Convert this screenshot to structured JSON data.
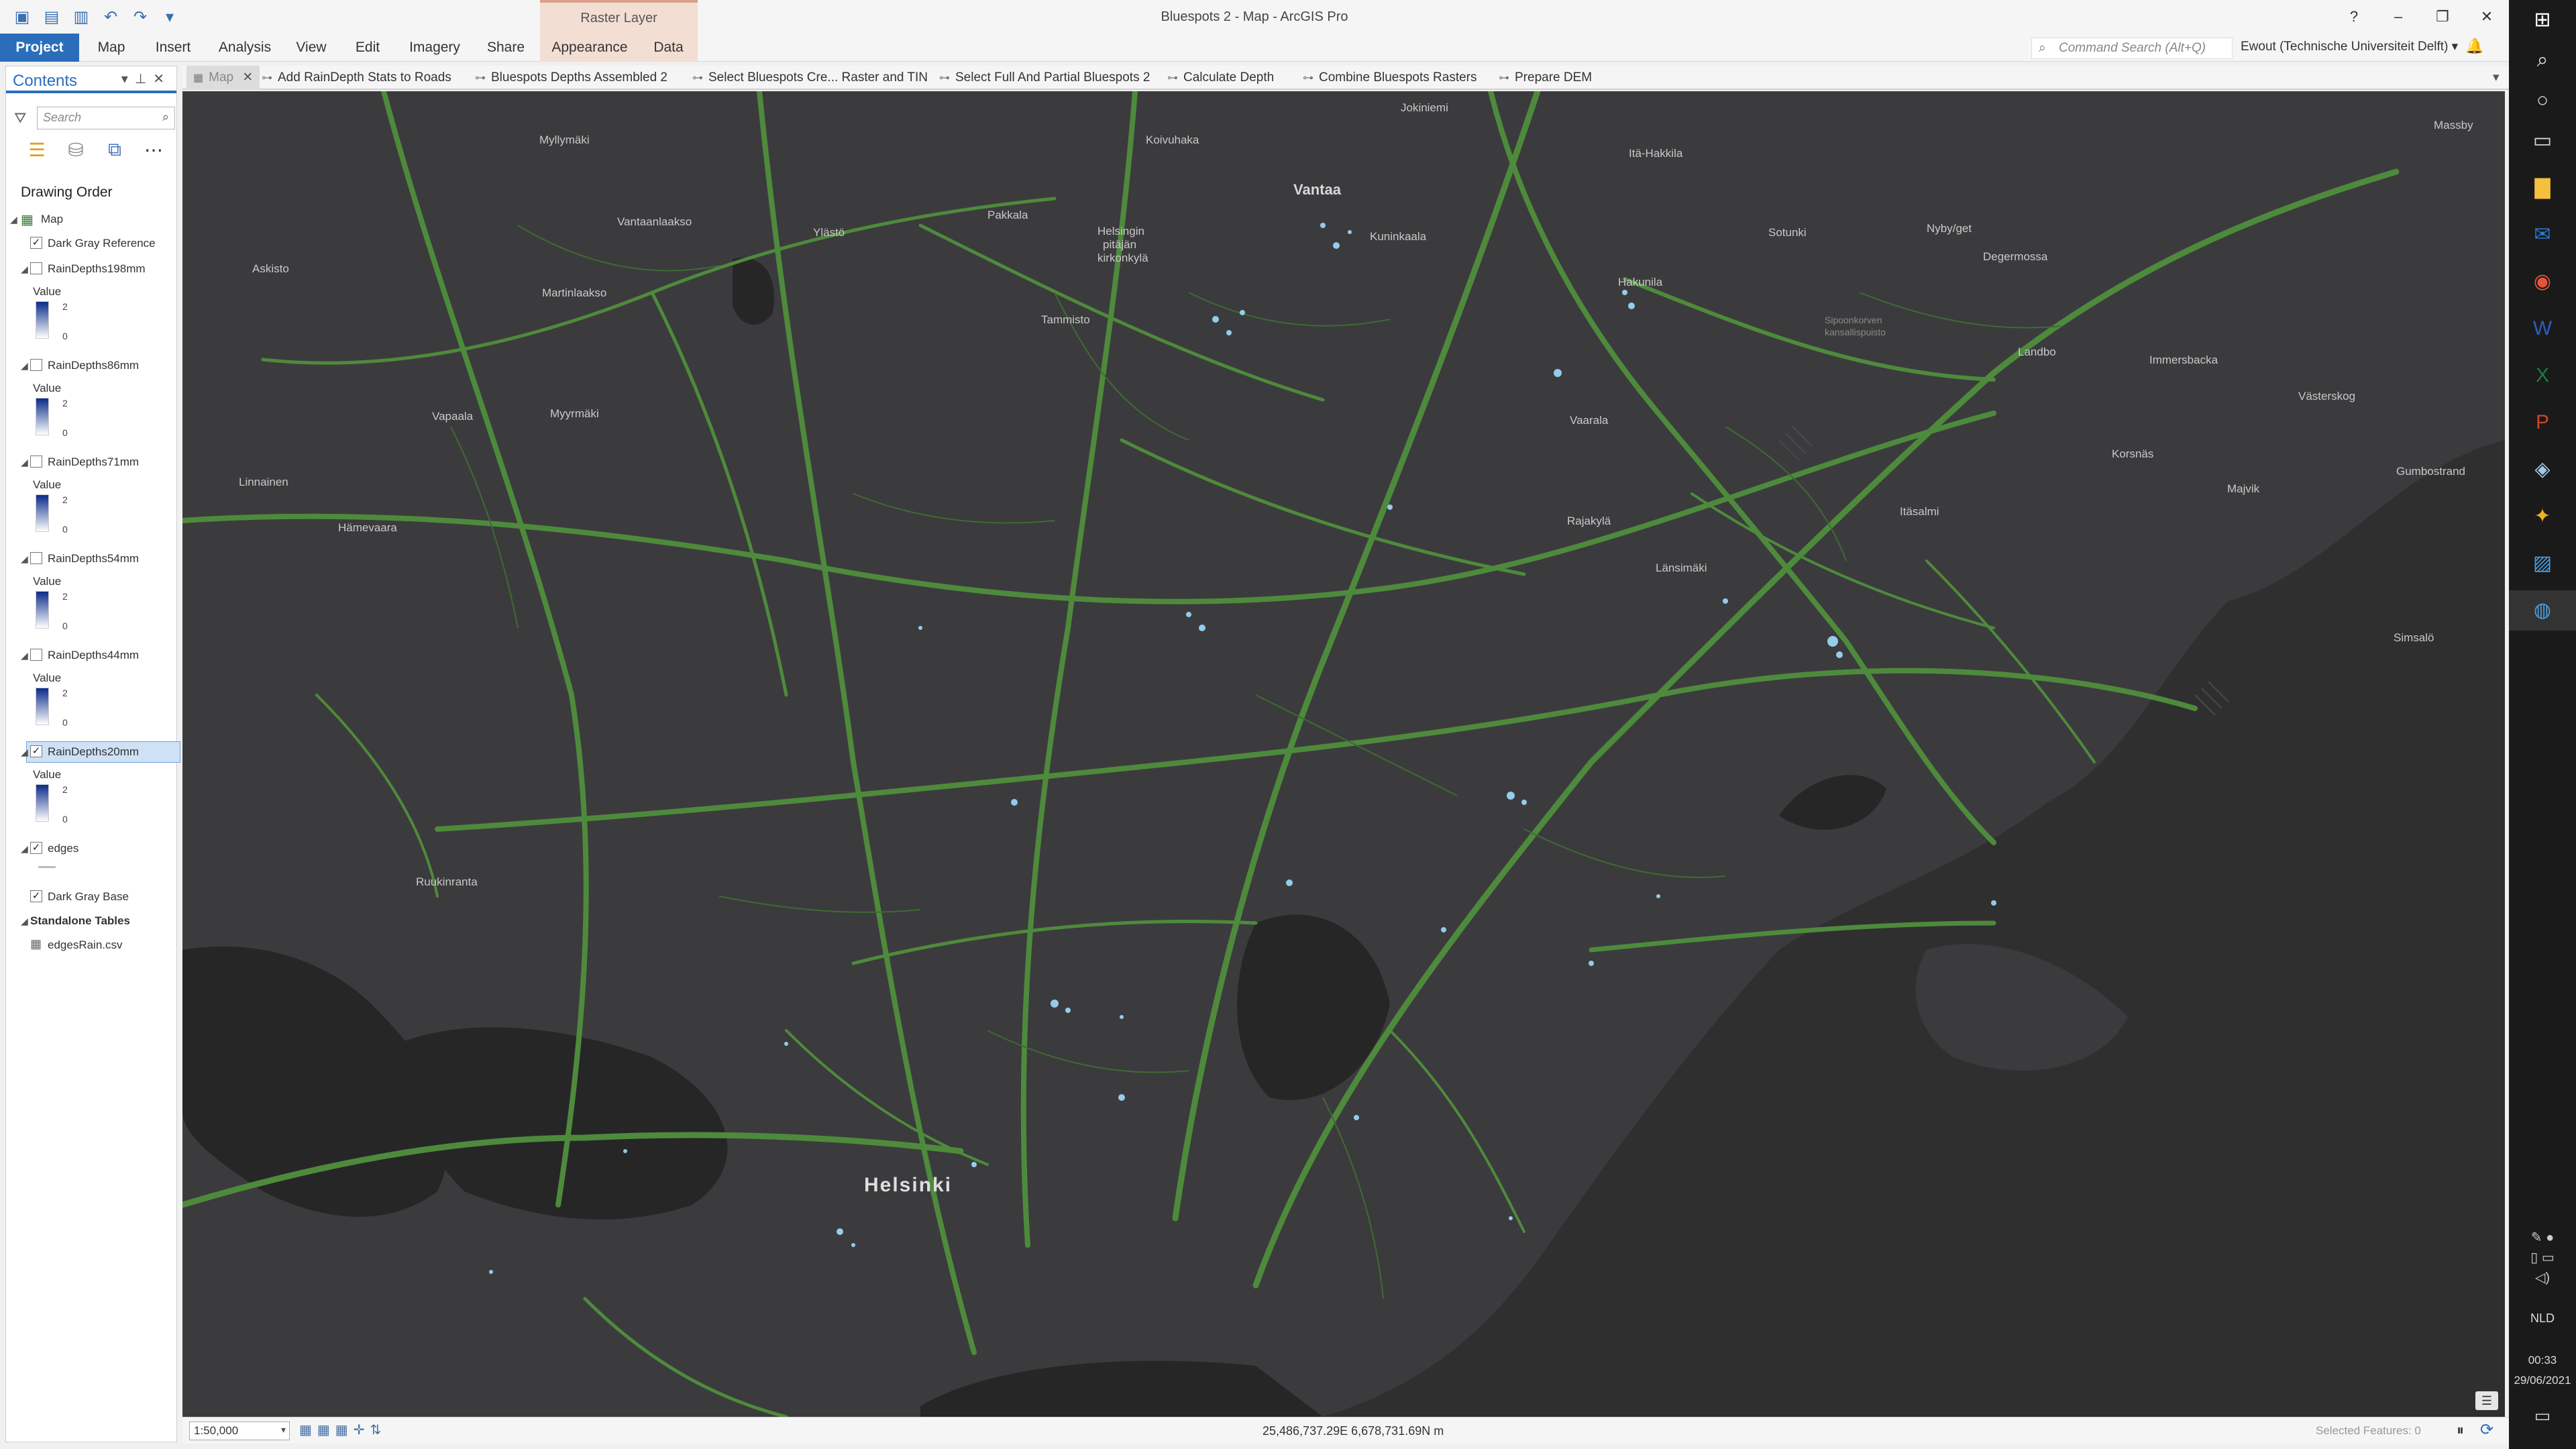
{
  "window": {
    "title": "Bluespots 2 - Map - ArcGIS Pro",
    "context_tab_header": "Raster Layer",
    "controls": [
      "?",
      "–",
      "❐",
      "✕"
    ]
  },
  "quick_access": [
    "new-project-icon",
    "open-project-icon",
    "save-project-icon",
    "undo-icon",
    "redo-icon",
    "customize-icon"
  ],
  "ribbon": {
    "tabs": [
      "Project",
      "Map",
      "Insert",
      "Analysis",
      "View",
      "Edit",
      "Imagery",
      "Share",
      "Appearance",
      "Data"
    ],
    "command_search_placeholder": "Command Search (Alt+Q)",
    "user": "Ewout (Technische Universiteit Delft) ▾"
  },
  "contents": {
    "title": "Contents",
    "search_placeholder": "Search",
    "drawing_order": "Drawing Order",
    "map_label": "Map",
    "reference_layer": "Dark Gray Reference",
    "legend_value_label": "Value",
    "legend_high": "2",
    "legend_low": "0",
    "layers": [
      {
        "name": "RainDepths198mm",
        "checked": false
      },
      {
        "name": "RainDepths86mm",
        "checked": false
      },
      {
        "name": "RainDepths71mm",
        "checked": false
      },
      {
        "name": "RainDepths54mm",
        "checked": false
      },
      {
        "name": "RainDepths44mm",
        "checked": false
      },
      {
        "name": "RainDepths20mm",
        "checked": true,
        "selected": true
      }
    ],
    "edges_layer": "edges",
    "base_layer": "Dark Gray Base",
    "standalone_tables": "Standalone Tables",
    "table_name": "edgesRain.csv"
  },
  "map_tabs": [
    "Map",
    "Add RainDepth Stats to Roads",
    "Bluespots Depths Assembled 2",
    "Select Bluespots Cre... Raster and TIN",
    "Select Full And Partial Bluespots 2",
    "Calculate Depth",
    "Combine Bluespots Rasters",
    "Prepare DEM"
  ],
  "map": {
    "colors": {
      "background": "#2f2f30",
      "land": "#3b3b3d",
      "water": "#262627",
      "roads": "#4e8a3c",
      "bluespots": "#9fdcff"
    },
    "places": [
      {
        "name": "Helsinki",
        "style": "big"
      },
      {
        "name": "Vantaa",
        "style": "mid"
      },
      {
        "name": "Myllymäki"
      },
      {
        "name": "Koivuhaka"
      },
      {
        "name": "Jokiniemi"
      },
      {
        "name": "Itä-Hakkila"
      },
      {
        "name": "Massby"
      },
      {
        "name": "Vantaanlaakso"
      },
      {
        "name": "Pakkala"
      },
      {
        "name": "Helsingin"
      },
      {
        "name": "pitäjän"
      },
      {
        "name": "kirkonkylä"
      },
      {
        "name": "Kuninkaala"
      },
      {
        "name": "Sotunki"
      },
      {
        "name": "Nyby/get"
      },
      {
        "name": "Degermossa"
      },
      {
        "name": "Ylästö"
      },
      {
        "name": "Askisto"
      },
      {
        "name": "Martinlaakso"
      },
      {
        "name": "Tammisto"
      },
      {
        "name": "Hakunila"
      },
      {
        "name": "Sipoonkorven",
        "style": "park"
      },
      {
        "name": "kansallispuisto",
        "style": "park"
      },
      {
        "name": "Landbo"
      },
      {
        "name": "Immersbacka"
      },
      {
        "name": "Västerskog"
      },
      {
        "name": "Vapaala"
      },
      {
        "name": "Myyrmäki"
      },
      {
        "name": "Vaarala"
      },
      {
        "name": "Korsnäs"
      },
      {
        "name": "Gumbostrand"
      },
      {
        "name": "Linnainen"
      },
      {
        "name": "Majvik"
      },
      {
        "name": "Hämevaara"
      },
      {
        "name": "Itäsalmi"
      },
      {
        "name": "Rajakylä"
      },
      {
        "name": "Länsimäki"
      },
      {
        "name": "Simsalö"
      },
      {
        "name": "Ruukinranta"
      }
    ]
  },
  "status": {
    "scale": "1:50,000",
    "coordinates": "25,486,737.29E 6,678,731.69N m",
    "selected_features": "Selected Features: 0"
  },
  "taskbar": {
    "language": "NLD",
    "time": "00:33",
    "date": "29/06/2021"
  }
}
